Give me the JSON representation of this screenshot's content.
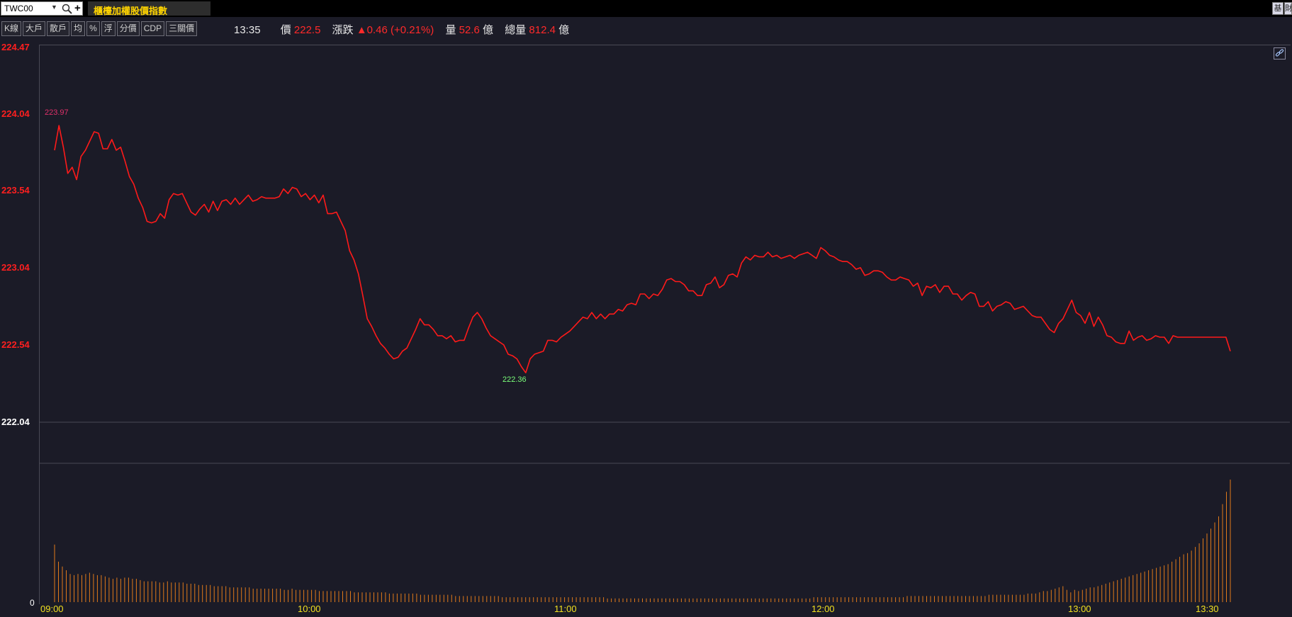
{
  "header": {
    "symbol": "TWC00",
    "title": "櫃檯加權股價指數",
    "right_buttons": [
      "基",
      "財"
    ]
  },
  "toolbar": {
    "buttons": [
      "K線",
      "大戶",
      "散戶",
      "均",
      "%",
      "浮",
      "分價",
      "CDP",
      "三關價"
    ]
  },
  "quote": {
    "time": "13:35",
    "price_label": "價",
    "price": "222.5",
    "change_label": "漲跌",
    "change": "▲0.46 (+0.21%)",
    "volume_label": "量",
    "volume": "52.6",
    "volume_unit": "億",
    "total_volume_label": "總量",
    "total_volume": "812.4",
    "total_volume_unit": "億"
  },
  "colors": {
    "price_line": "#ff1a1a",
    "volume_bar": "#e07a1a",
    "axis_price": "#ff1f1f",
    "axis_time": "#f0e020",
    "high_label": "#e0306a",
    "low_label": "#7aff7a"
  },
  "chart_data": {
    "type": "line",
    "y_ticks": [
      "224.47",
      "224.04",
      "223.54",
      "223.04",
      "222.54",
      "222.04"
    ],
    "x_ticks": [
      "09:00",
      "10:00",
      "11:00",
      "12:00",
      "13:00",
      "13:30"
    ],
    "ylim": [
      222.04,
      224.47
    ],
    "high_label": "223.97",
    "low_label": "222.36",
    "volume_zero_label": "0",
    "series": [
      {
        "values": [
          223.8,
          223.96,
          223.82,
          223.65,
          223.69,
          223.61,
          223.76,
          223.8,
          223.86,
          223.92,
          223.91,
          223.81,
          223.81,
          223.87,
          223.8,
          223.82,
          223.73,
          223.63,
          223.58,
          223.49,
          223.43,
          223.34,
          223.33,
          223.34,
          223.39,
          223.36,
          223.48,
          223.52,
          223.51,
          223.52,
          223.46,
          223.4,
          223.38,
          223.42,
          223.45,
          223.4,
          223.47,
          223.41,
          223.47,
          223.48,
          223.45,
          223.49,
          223.45,
          223.48,
          223.51,
          223.47,
          223.48,
          223.5,
          223.49,
          223.49,
          223.49,
          223.5,
          223.55,
          223.52,
          223.56,
          223.55,
          223.5,
          223.52,
          223.48,
          223.51,
          223.46,
          223.51,
          223.39,
          223.39,
          223.4,
          223.34,
          223.28,
          223.15,
          223.09,
          223.0,
          222.86,
          222.71,
          222.66,
          222.6,
          222.55,
          222.52,
          222.48,
          222.45,
          222.46,
          222.5,
          222.52,
          222.58,
          222.64,
          222.71,
          222.67,
          222.67,
          222.64,
          222.6,
          222.6,
          222.58,
          222.6,
          222.56,
          222.57,
          222.57,
          222.65,
          222.72,
          222.75,
          222.71,
          222.65,
          222.6,
          222.58,
          222.56,
          222.54,
          222.48,
          222.47,
          222.45,
          222.4,
          222.36,
          222.45,
          222.48,
          222.49,
          222.5,
          222.57,
          222.57,
          222.56,
          222.59,
          222.61,
          222.63,
          222.66,
          222.69,
          222.72,
          222.71,
          222.75,
          222.71,
          222.74,
          222.71,
          222.74,
          222.74,
          222.77,
          222.76,
          222.8,
          222.81,
          222.8,
          222.87,
          222.87,
          222.84,
          222.87,
          222.86,
          222.9,
          222.96,
          222.97,
          222.95,
          222.95,
          222.93,
          222.89,
          222.89,
          222.86,
          222.86,
          222.93,
          222.94,
          222.98,
          222.91,
          222.93,
          222.99,
          223.0,
          222.98,
          223.07,
          223.11,
          223.09,
          223.12,
          223.11,
          223.11,
          223.14,
          223.11,
          223.12,
          223.1,
          223.11,
          223.12,
          223.1,
          223.12,
          223.13,
          223.14,
          223.12,
          223.1,
          223.17,
          223.15,
          223.12,
          223.11,
          223.09,
          223.08,
          223.08,
          223.06,
          223.03,
          223.04,
          222.99,
          223.0,
          223.02,
          223.02,
          223.01,
          222.98,
          222.96,
          222.96,
          222.98,
          222.97,
          222.96,
          222.92,
          222.94,
          222.86,
          222.92,
          222.91,
          222.93,
          222.88,
          222.92,
          222.92,
          222.87,
          222.87,
          222.83,
          222.86,
          222.88,
          222.87,
          222.79,
          222.79,
          222.82,
          222.76,
          222.79,
          222.8,
          222.82,
          222.81,
          222.77,
          222.78,
          222.79,
          222.76,
          222.73,
          222.72,
          222.72,
          222.68,
          222.64,
          222.62,
          222.68,
          222.71,
          222.77,
          222.83,
          222.75,
          222.73,
          222.68,
          222.75,
          222.66,
          222.72,
          222.67,
          222.6,
          222.59,
          222.56,
          222.55,
          222.55,
          222.63,
          222.57,
          222.59,
          222.6,
          222.57,
          222.58,
          222.6,
          222.59,
          222.59,
          222.55,
          222.6,
          222.59,
          222.59,
          222.59,
          222.59,
          222.59,
          222.59,
          222.59,
          222.59,
          222.59,
          222.59,
          222.59,
          222.59,
          222.5
        ]
      }
    ],
    "volume": [
      47,
      33,
      29,
      26,
      23,
      22,
      23,
      22,
      23,
      24,
      23,
      22,
      22,
      21,
      20,
      19,
      20,
      19,
      20,
      20,
      19,
      19,
      18,
      17,
      17,
      17,
      17,
      16,
      16,
      17,
      16,
      16,
      16,
      16,
      15,
      15,
      15,
      14,
      14,
      14,
      14,
      13,
      13,
      13,
      13,
      12,
      12,
      12,
      12,
      12,
      12,
      11,
      11,
      11,
      11,
      11,
      11,
      11,
      11,
      10,
      10,
      11,
      10,
      10,
      10,
      10,
      10,
      10,
      9,
      9,
      9,
      9,
      9,
      9,
      9,
      9,
      9,
      8,
      8,
      8,
      8,
      8,
      8,
      8,
      8,
      8,
      7,
      7,
      7,
      7,
      7,
      7,
      7,
      7,
      6,
      6,
      6,
      6,
      6,
      6,
      6,
      6,
      6,
      5,
      5,
      5,
      5,
      5,
      5,
      5,
      5,
      5,
      5,
      5,
      5,
      4,
      4,
      4,
      4,
      4,
      4,
      4,
      4,
      4,
      4,
      4,
      4,
      4,
      4,
      4,
      4,
      4,
      4,
      4,
      4,
      4,
      4,
      4,
      4,
      4,
      4,
      4,
      3,
      3,
      3,
      3,
      3,
      3,
      3,
      3,
      3,
      3,
      3,
      3,
      3,
      3,
      3,
      3,
      3,
      3,
      3,
      3,
      3,
      3,
      3,
      3,
      3,
      3,
      3,
      3,
      3,
      3,
      3,
      3,
      3,
      3,
      3,
      3,
      3,
      3,
      3,
      3,
      3,
      3,
      3,
      3,
      3,
      3,
      3,
      3,
      3,
      3,
      3,
      3,
      3,
      4,
      4,
      4,
      4,
      4,
      4,
      4,
      4,
      4,
      4,
      4,
      4,
      4,
      4,
      4,
      4,
      4,
      4,
      4,
      4,
      4,
      4,
      4,
      4,
      5,
      5,
      5,
      5,
      5,
      5,
      5,
      5,
      5,
      5,
      5,
      5,
      5,
      5,
      5,
      5,
      5,
      5,
      5,
      5,
      5,
      6,
      6,
      6,
      6,
      6,
      6,
      6,
      6,
      6,
      6,
      7,
      7,
      7,
      8,
      9,
      9,
      10,
      11,
      12,
      13,
      10,
      8,
      10,
      9,
      10,
      11,
      12,
      12,
      13,
      14,
      15,
      16,
      17,
      18,
      19,
      20,
      21,
      22,
      23,
      24,
      25,
      26,
      27,
      28,
      29,
      30,
      31,
      33,
      35,
      37,
      39,
      40,
      42,
      45,
      48,
      52,
      56,
      60,
      65,
      70,
      80,
      90,
      100
    ]
  }
}
